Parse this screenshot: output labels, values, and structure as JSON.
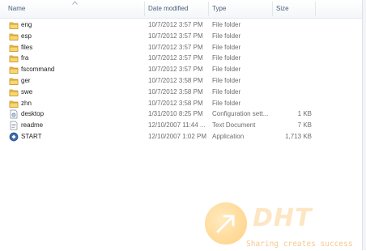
{
  "columns": {
    "name": "Name",
    "date_modified": "Date modified",
    "type": "Type",
    "size": "Size"
  },
  "files": [
    {
      "name": "eng",
      "date": "10/7/2012 3:57 PM",
      "type": "File folder",
      "size": "",
      "icon": "folder-icon"
    },
    {
      "name": "esp",
      "date": "10/7/2012 3:57 PM",
      "type": "File folder",
      "size": "",
      "icon": "folder-icon"
    },
    {
      "name": "files",
      "date": "10/7/2012 3:57 PM",
      "type": "File folder",
      "size": "",
      "icon": "folder-icon"
    },
    {
      "name": "fra",
      "date": "10/7/2012 3:57 PM",
      "type": "File folder",
      "size": "",
      "icon": "folder-icon"
    },
    {
      "name": "fscommand",
      "date": "10/7/2012 3:57 PM",
      "type": "File folder",
      "size": "",
      "icon": "folder-icon"
    },
    {
      "name": "ger",
      "date": "10/7/2012 3:58 PM",
      "type": "File folder",
      "size": "",
      "icon": "folder-icon"
    },
    {
      "name": "swe",
      "date": "10/7/2012 3:58 PM",
      "type": "File folder",
      "size": "",
      "icon": "folder-icon"
    },
    {
      "name": "zhn",
      "date": "10/7/2012 3:58 PM",
      "type": "File folder",
      "size": "",
      "icon": "folder-icon"
    },
    {
      "name": "desktop",
      "date": "1/31/2010 8:25 PM",
      "type": "Configuration sett...",
      "size": "1 KB",
      "icon": "config-file-icon"
    },
    {
      "name": "readme",
      "date": "12/10/2007 11:44 ...",
      "type": "Text Document",
      "size": "7 KB",
      "icon": "text-file-icon"
    },
    {
      "name": "START",
      "date": "12/10/2007 1:02 PM",
      "type": "Application",
      "size": "1,713 KB",
      "icon": "application-icon"
    }
  ],
  "watermark": {
    "logo_text": "DHT",
    "tagline": "Sharing creates success"
  },
  "colors": {
    "folder": "#e8b33a",
    "header_text": "#4c607a",
    "detail_text": "#6d6d6d"
  }
}
